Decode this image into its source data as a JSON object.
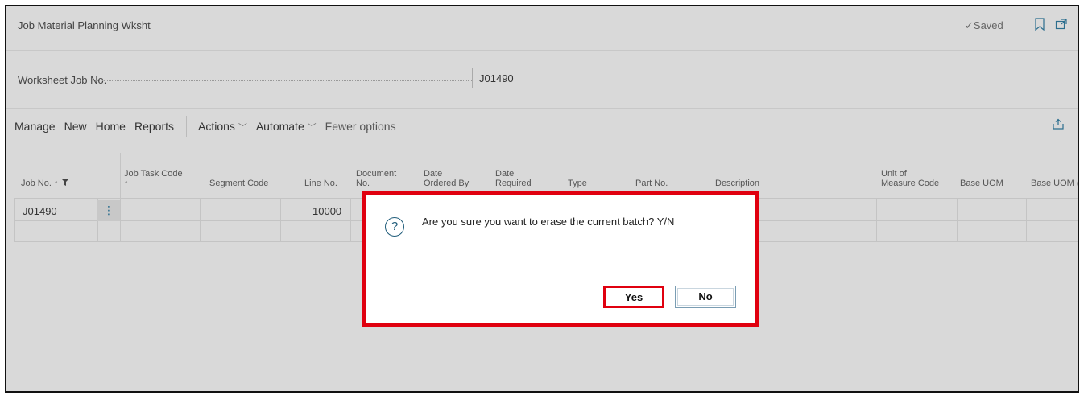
{
  "page": {
    "title": "Job Material Planning Wksht",
    "saved_label": "Saved"
  },
  "field": {
    "label": "Worksheet Job No.",
    "value": "J01490"
  },
  "actions": {
    "manage": "Manage",
    "new": "New",
    "home": "Home",
    "reports": "Reports",
    "actions": "Actions",
    "automate": "Automate",
    "fewer": "Fewer options"
  },
  "columns": {
    "job_no": "Job No. ↑",
    "job_task_code_1": "Job Task Code",
    "job_task_code_2": "↑",
    "segment_code": "Segment Code",
    "line_no": "Line No.",
    "document_no_1": "Document",
    "document_no_2": "No.",
    "date_ordered_1": "Date",
    "date_ordered_2": "Ordered By",
    "date_required_1": "Date",
    "date_required_2": "Required",
    "type": "Type",
    "part_no": "Part No.",
    "description": "Description",
    "uom_1": "Unit of",
    "uom_2": "Measure Code",
    "base_uom": "Base UOM",
    "base_uom_2": "Base UOM ("
  },
  "rows": [
    {
      "job_no": "J01490",
      "line_no": "10000"
    }
  ],
  "dialog": {
    "message": "Are you sure you want to erase the current batch? Y/N",
    "yes": "Yes",
    "no": "No"
  }
}
